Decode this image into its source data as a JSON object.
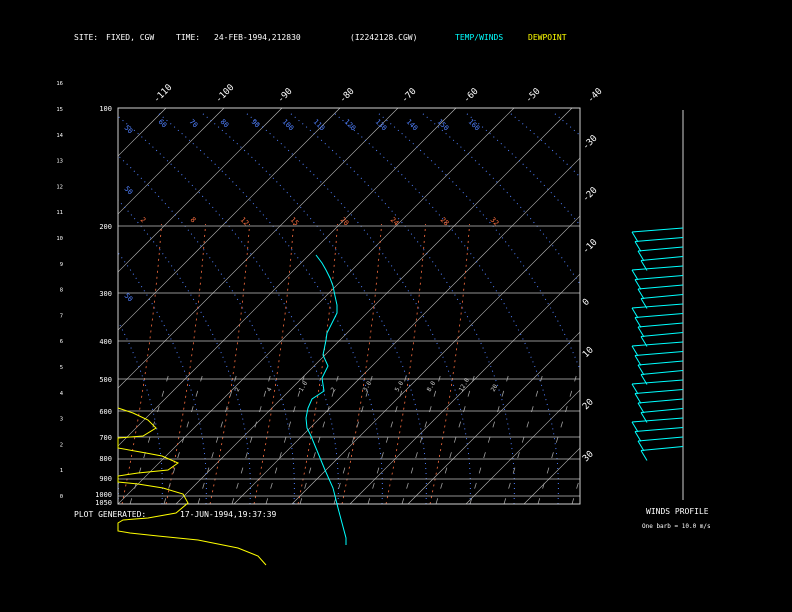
{
  "header": {
    "site_label": "SITE:",
    "site_value": "FIXED, CGW",
    "time_label": "TIME:",
    "time_value": "24-FEB-1994,212830",
    "file_value": "(I2242128.CGW)",
    "legend_temp": "TEMP/WINDS",
    "legend_dew": "DEWPOINT"
  },
  "footer": {
    "plot_label": "PLOT GENERATED:",
    "plot_value": "17-JUN-1994,19:37:39",
    "winds_title": "WINDS PROFILE",
    "barb_note": "One barb = 10.0 m/s"
  },
  "colors": {
    "background": "#000000",
    "temp": "#00ffff",
    "dewpoint": "#ffff00",
    "isobar": "#c0c0c0",
    "isotherm": "#c0c0c0",
    "dry_adiabat": "#5080ff",
    "mixing_ratio": "#ff7040",
    "moist_adiabat": "#a0a0a0"
  },
  "chart_data": {
    "type": "line",
    "subtype": "skew-t",
    "pressure_labels": [
      "100",
      "200",
      "300",
      "400",
      "500",
      "600",
      "700",
      "800",
      "900",
      "1000",
      "1050"
    ],
    "height_labels": [
      "0",
      "1",
      "2",
      "3",
      "4",
      "5",
      "6",
      "7",
      "8",
      "9",
      "10",
      "11",
      "12",
      "13",
      "14",
      "15",
      "16"
    ],
    "temp_top_labels": [
      "-110",
      "-100",
      "-90",
      "-80",
      "-70",
      "-60",
      "-50",
      "-40"
    ],
    "temp_right_labels": [
      "-30",
      "-20",
      "-10",
      "0",
      "10",
      "20",
      "30"
    ],
    "theta_labels": [
      "50",
      "50",
      "50",
      "60",
      "70",
      "80",
      "90",
      "100",
      "110",
      "120",
      "130",
      "140",
      "150",
      "160"
    ],
    "mixing_labels": [
      "2",
      "8",
      "12",
      "15",
      "20",
      "24",
      "28",
      "32"
    ],
    "lower_labels": [
      "2",
      "4",
      "1.0",
      "2",
      "3.0",
      "5.0",
      "8.0",
      "12.0",
      "20"
    ],
    "series": [
      {
        "name": "TEMP/WINDS",
        "points": [
          [
            228,
            437
          ],
          [
            228,
            430
          ],
          [
            220,
            400
          ],
          [
            215,
            380
          ],
          [
            207,
            362
          ],
          [
            200,
            345
          ],
          [
            193,
            328
          ],
          [
            189,
            320
          ],
          [
            188,
            310
          ],
          [
            190,
            300
          ],
          [
            194,
            291
          ],
          [
            200,
            287
          ],
          [
            206,
            283
          ],
          [
            204,
            270
          ],
          [
            210,
            258
          ],
          [
            205,
            247
          ],
          [
            208,
            232
          ],
          [
            209,
            225
          ],
          [
            214,
            215
          ],
          [
            219,
            205
          ],
          [
            219,
            197
          ],
          [
            217,
            188
          ],
          [
            215,
            178
          ],
          [
            212,
            170
          ],
          [
            208,
            162
          ],
          [
            204,
            155
          ],
          [
            198,
            147
          ]
        ]
      },
      {
        "name": "DEWPOINT",
        "points": [
          [
            148,
            457
          ],
          [
            140,
            448
          ],
          [
            120,
            440
          ],
          [
            80,
            432
          ],
          [
            40,
            428
          ],
          [
            12,
            425
          ],
          [
            0,
            423
          ],
          [
            0,
            415
          ],
          [
            5,
            412
          ],
          [
            30,
            410
          ],
          [
            58,
            405
          ],
          [
            70,
            395
          ],
          [
            65,
            386
          ],
          [
            45,
            380
          ],
          [
            20,
            376
          ],
          [
            0,
            374
          ],
          [
            0,
            368
          ],
          [
            20,
            365
          ],
          [
            50,
            362
          ],
          [
            60,
            355
          ],
          [
            44,
            348
          ],
          [
            28,
            345
          ],
          [
            0,
            340
          ],
          [
            0,
            330
          ],
          [
            25,
            328
          ],
          [
            38,
            320
          ],
          [
            30,
            312
          ],
          [
            15,
            305
          ],
          [
            0,
            300
          ]
        ]
      }
    ]
  }
}
